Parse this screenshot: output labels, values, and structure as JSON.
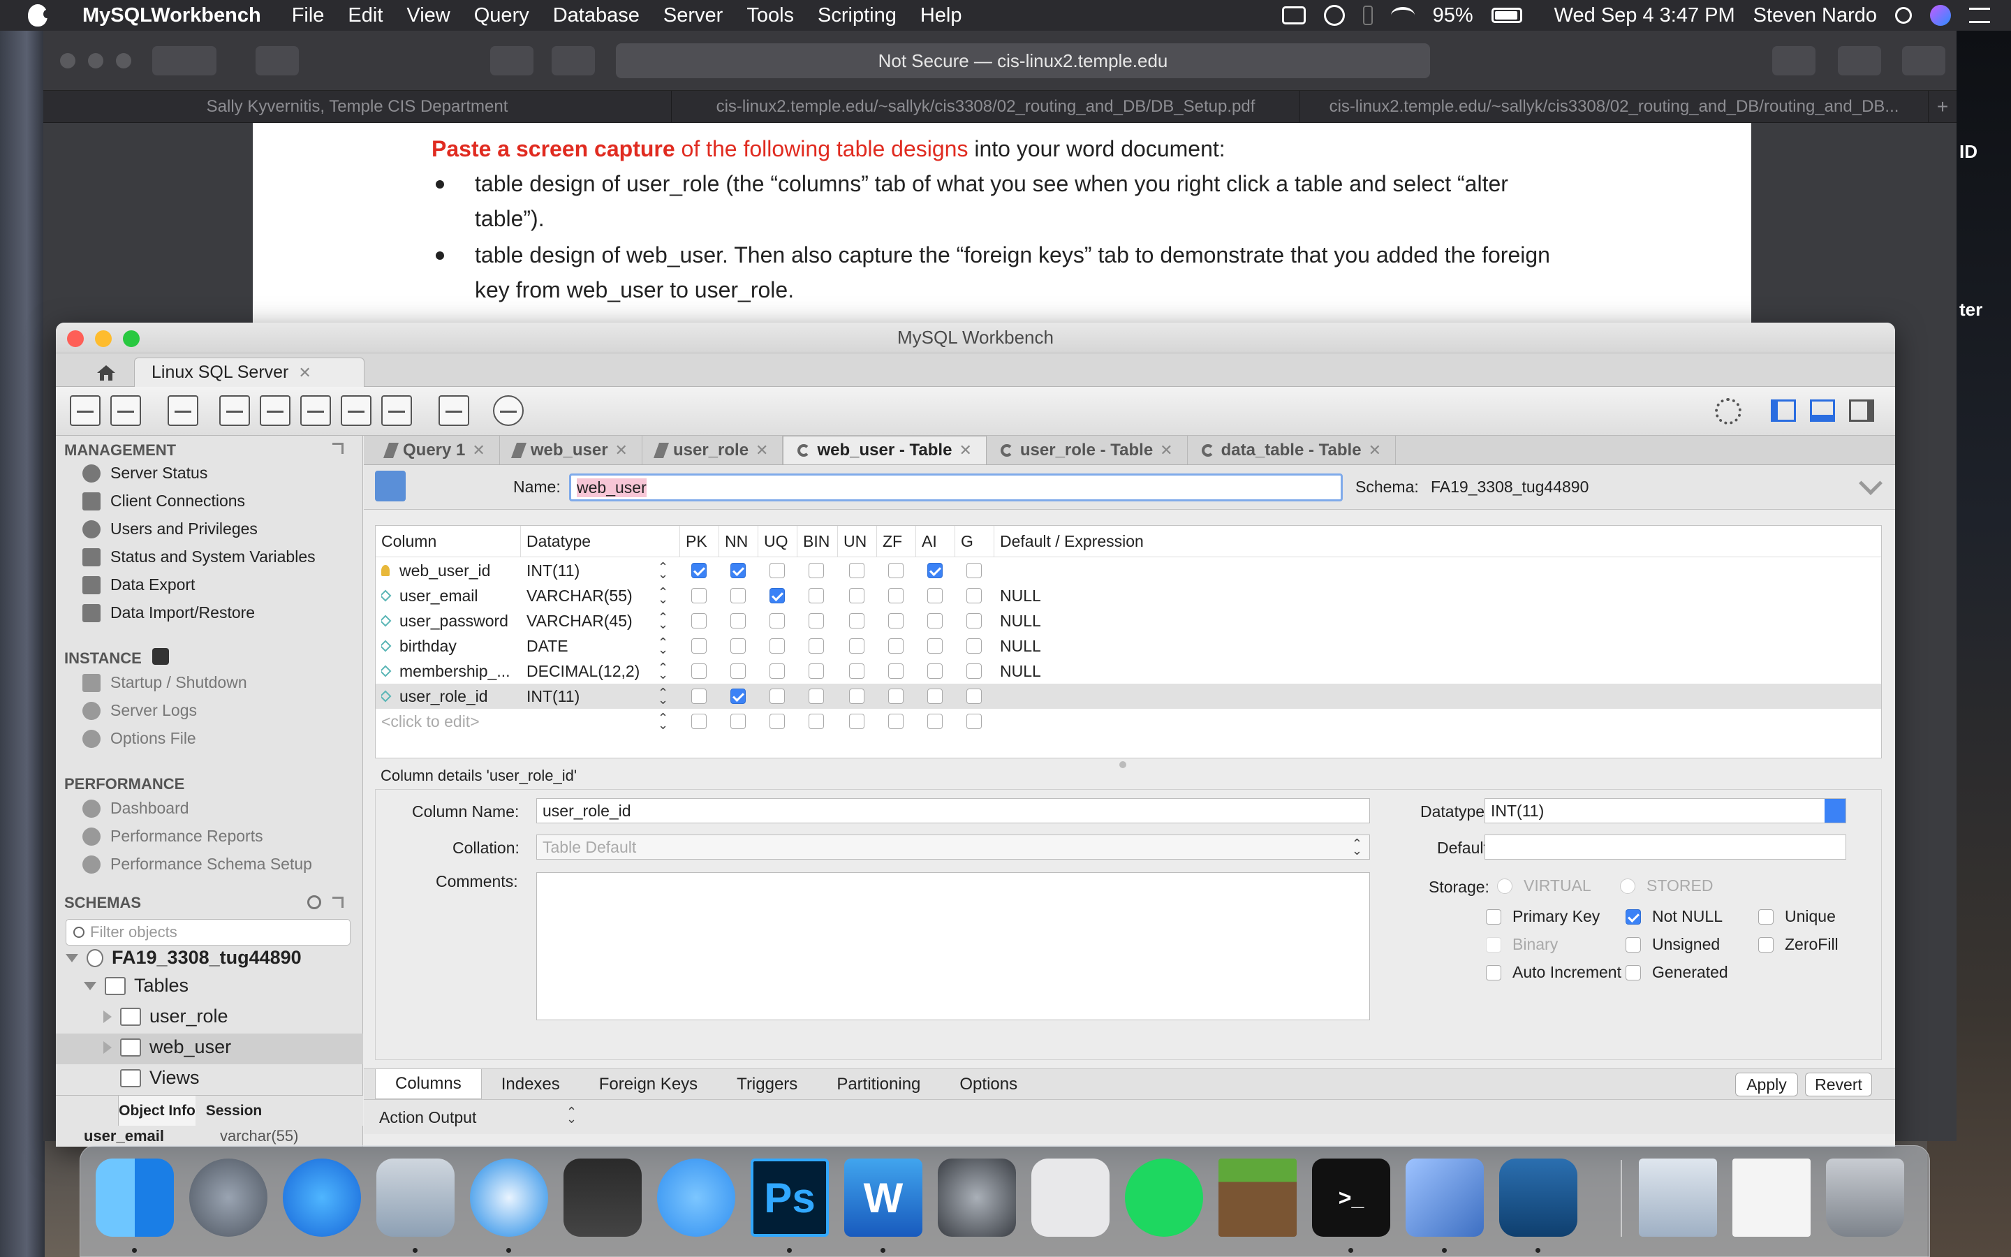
{
  "menubar": {
    "app_name": "MySQLWorkbench",
    "items": [
      "File",
      "Edit",
      "View",
      "Query",
      "Database",
      "Server",
      "Tools",
      "Scripting",
      "Help"
    ],
    "battery": "95%",
    "datetime": "Wed Sep 4  3:47 PM",
    "user": "Steven Nardo"
  },
  "safari": {
    "address": "Not Secure — cis-linux2.temple.edu",
    "tabs": [
      "Sally Kyvernitis, Temple CIS Department",
      "cis-linux2.temple.edu/~sallyk/cis3308/02_routing_and_DB/DB_Setup.pdf",
      "cis-linux2.temple.edu/~sallyk/cis3308/02_routing_and_DB/routing_and_DB..."
    ],
    "plus": "+"
  },
  "document": {
    "lead_bold": "Paste a screen capture",
    "lead_red": " of the following table designs",
    "lead_rest": " into your word document:",
    "bullet1_line1": "table design of user_role (the “columns” tab of what you see when you right click a table and select “alter",
    "bullet1_line2": "table”).",
    "bullet2_line1": "table design of web_user. Then also capture the “foreign keys” tab to demonstrate that you added the foreign",
    "bullet2_line2": "key from web_user to user_role."
  },
  "peek_right": {
    "top": "ID",
    "mid": "ter"
  },
  "workbench": {
    "title": "MySQL Workbench",
    "connection_tab": "Linux SQL Server",
    "close": "✕",
    "sidebar": {
      "management_title": "MANAGEMENT",
      "management": [
        "Server Status",
        "Client Connections",
        "Users and Privileges",
        "Status and System Variables",
        "Data Export",
        "Data Import/Restore"
      ],
      "instance_title": "INSTANCE",
      "instance": [
        "Startup / Shutdown",
        "Server Logs",
        "Options File"
      ],
      "performance_title": "PERFORMANCE",
      "performance": [
        "Dashboard",
        "Performance Reports",
        "Performance Schema Setup"
      ],
      "schemas_title": "SCHEMAS",
      "filter_placeholder": "Filter objects",
      "schema_name": "FA19_3308_tug44890",
      "tables_label": "Tables",
      "table1": "user_role",
      "table2": "web_user",
      "views_label": "Views",
      "obj_tabs": [
        "Object Info",
        "Session"
      ],
      "info_name": "user_email",
      "info_type": "varchar(55)"
    },
    "editor_tabs": [
      {
        "label": "Query 1",
        "icon": "flash-icon"
      },
      {
        "label": "web_user",
        "icon": "flash-icon"
      },
      {
        "label": "user_role",
        "icon": "flash-icon"
      },
      {
        "label": "web_user - Table",
        "icon": "wrench-icon",
        "active": true
      },
      {
        "label": "user_role - Table",
        "icon": "wrench-icon"
      },
      {
        "label": "data_table - Table",
        "icon": "wrench-icon"
      }
    ],
    "name_label": "Name:",
    "name_value": "web_user",
    "schema_label": "Schema:",
    "schema_value": "FA19_3308_tug44890",
    "grid": {
      "headers": [
        "Column",
        "Datatype",
        "PK",
        "NN",
        "UQ",
        "BIN",
        "UN",
        "ZF",
        "AI",
        "G",
        "Default / Expression"
      ],
      "rows": [
        {
          "name": "web_user_id",
          "type": "INT(11)",
          "flags": [
            1,
            1,
            0,
            0,
            0,
            0,
            1,
            0
          ],
          "default": "",
          "key": true
        },
        {
          "name": "user_email",
          "type": "VARCHAR(55)",
          "flags": [
            0,
            0,
            1,
            0,
            0,
            0,
            0,
            0
          ],
          "default": "NULL"
        },
        {
          "name": "user_password",
          "type": "VARCHAR(45)",
          "flags": [
            0,
            0,
            0,
            0,
            0,
            0,
            0,
            0
          ],
          "default": "NULL"
        },
        {
          "name": "birthday",
          "type": "DATE",
          "flags": [
            0,
            0,
            0,
            0,
            0,
            0,
            0,
            0
          ],
          "default": "NULL"
        },
        {
          "name": "membership_...",
          "type": "DECIMAL(12,2)",
          "flags": [
            0,
            0,
            0,
            0,
            0,
            0,
            0,
            0
          ],
          "default": "NULL"
        },
        {
          "name": "user_role_id",
          "type": "INT(11)",
          "flags": [
            0,
            1,
            0,
            0,
            0,
            0,
            0,
            0
          ],
          "default": "",
          "selected": true
        }
      ],
      "new_row": "<click to edit>"
    },
    "details": {
      "title": "Column details 'user_role_id'",
      "column_name_label": "Column Name:",
      "column_name": "user_role_id",
      "collation_label": "Collation:",
      "collation": "Table Default",
      "comments_label": "Comments:",
      "datatype_label": "Datatype:",
      "datatype": "INT(11)",
      "default_label": "Default",
      "storage_label": "Storage:",
      "virtual": "VIRTUAL",
      "stored": "STORED",
      "primary_key": "Primary Key",
      "not_null": "Not NULL",
      "unique": "Unique",
      "binary": "Binary",
      "unsigned": "Unsigned",
      "zerofill": "ZeroFill",
      "auto_increment": "Auto Increment",
      "generated": "Generated"
    },
    "bottom_tabs": [
      "Columns",
      "Indexes",
      "Foreign Keys",
      "Triggers",
      "Partitioning",
      "Options"
    ],
    "apply": "Apply",
    "revert": "Revert",
    "action_output": "Action Output"
  },
  "dock": [
    "Finder",
    "Launchpad",
    "App Store",
    "Mail",
    "Safari",
    "Photos",
    "Messages",
    "Photoshop",
    "Word",
    "System Preferences",
    "Screenshot",
    "Spotify",
    "Minecraft",
    "Terminal",
    "VirtualBox",
    "MySQL Workbench",
    "Folder",
    "Documents",
    "Trash"
  ],
  "dock_labels": {
    "ps": "Ps",
    "word": "W",
    "term": ">_"
  }
}
